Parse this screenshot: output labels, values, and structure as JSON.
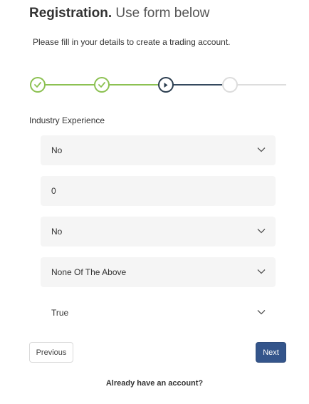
{
  "header": {
    "title_strong": "Registration.",
    "title_light": "Use form below",
    "subtitle": "Please fill in your details to create a trading account."
  },
  "stepper": {
    "total_steps": 4,
    "completed_steps": 2,
    "current_step": 3,
    "colors": {
      "done": "#8cc152",
      "current": "#2c3e50",
      "pending": "#dcdcdc"
    }
  },
  "section": {
    "label": "Industry Experience"
  },
  "fields": [
    {
      "value": "No",
      "type": "select",
      "icon": "chevron-down-icon"
    },
    {
      "value": "0",
      "type": "text"
    },
    {
      "value": "No",
      "type": "select",
      "icon": "chevron-down-icon"
    },
    {
      "value": "None Of The Above",
      "type": "select",
      "icon": "chevron-down-icon"
    },
    {
      "value": "True",
      "type": "select",
      "icon": "chevron-down-icon"
    }
  ],
  "buttons": {
    "previous_label": "Previous",
    "next_label": "Next",
    "next_color": "#34558b"
  },
  "footer": {
    "login_link": "Already have an account?"
  }
}
